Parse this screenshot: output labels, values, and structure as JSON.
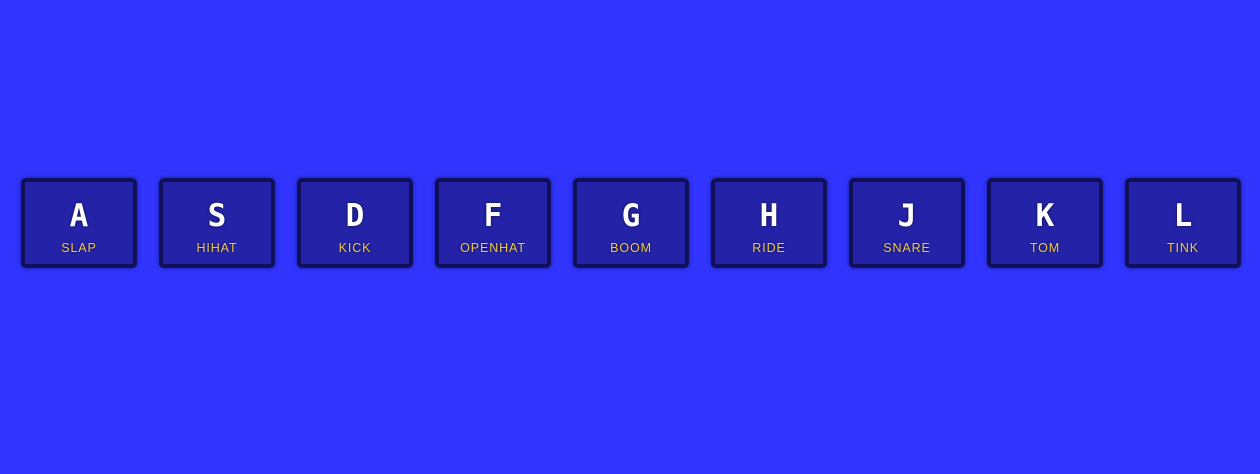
{
  "keys": [
    {
      "letter": "A",
      "sound": "SLAP"
    },
    {
      "letter": "S",
      "sound": "HIHAT"
    },
    {
      "letter": "D",
      "sound": "KICK"
    },
    {
      "letter": "F",
      "sound": "OPENHAT"
    },
    {
      "letter": "G",
      "sound": "BOOM"
    },
    {
      "letter": "H",
      "sound": "RIDE"
    },
    {
      "letter": "J",
      "sound": "SNARE"
    },
    {
      "letter": "K",
      "sound": "TOM"
    },
    {
      "letter": "L",
      "sound": "TINK"
    }
  ],
  "colors": {
    "background": "#3034fd",
    "key_fill": "#2423a8",
    "key_border": "#10105a",
    "letter": "#ffffff",
    "sound_label": "#f2c94c"
  }
}
